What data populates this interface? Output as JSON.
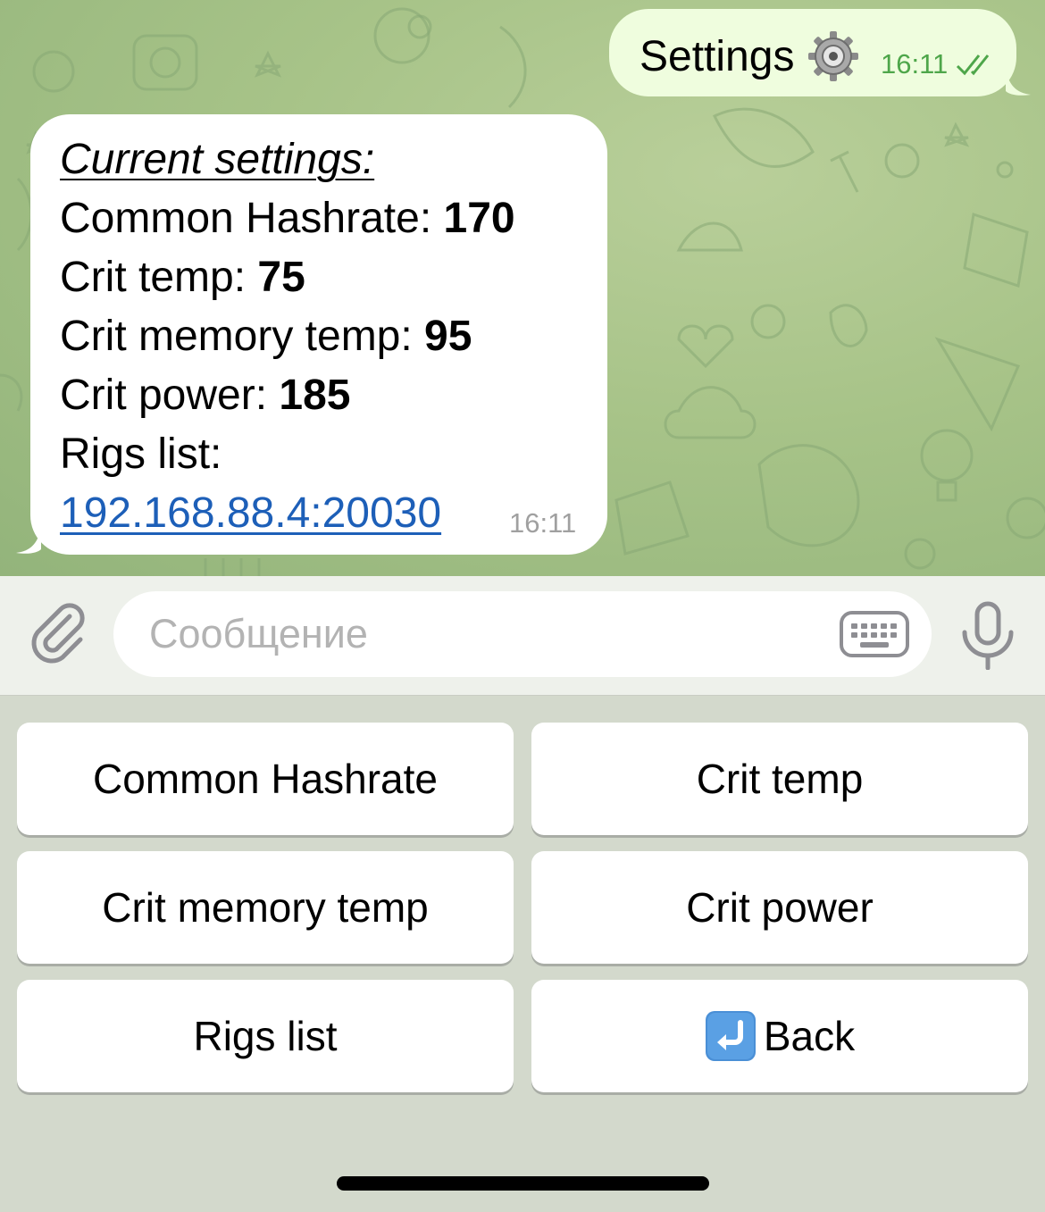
{
  "outgoing": {
    "text": "Settings",
    "icon": "gear-icon",
    "time": "16:11",
    "status": "read-double-check"
  },
  "incoming": {
    "title": "Current settings:",
    "lines": [
      {
        "label": "Common Hashrate: ",
        "value": "170"
      },
      {
        "label": "Crit temp: ",
        "value": "75"
      },
      {
        "label": "Crit memory temp: ",
        "value": "95"
      },
      {
        "label": "Crit power: ",
        "value": "185"
      }
    ],
    "rigs_label": "Rigs list:",
    "rigs_link": "192.168.88.4:20030",
    "time": "16:11"
  },
  "input": {
    "placeholder": "Сообщение"
  },
  "keyboard": {
    "buttons": [
      {
        "label": "Common Hashrate"
      },
      {
        "label": "Crit temp"
      },
      {
        "label": "Crit memory temp"
      },
      {
        "label": "Crit power"
      },
      {
        "label": "Rigs list"
      },
      {
        "label": "Back",
        "icon": "return-arrow-icon"
      }
    ]
  },
  "colors": {
    "outgoing_bubble": "#effdde",
    "time_out": "#4ea64a",
    "link": "#1d5fb8",
    "chat_background": "#a7c388"
  }
}
